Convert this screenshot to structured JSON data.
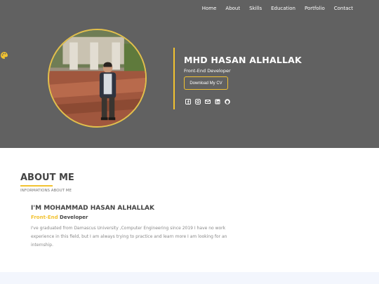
{
  "nav": {
    "items": [
      "Home",
      "About",
      "Skills",
      "Education",
      "Portfolio",
      "Contact"
    ]
  },
  "hero": {
    "name": "MHD HASAN ALHALLAK",
    "role": "Front-End Developer",
    "cv_button": "Download My CV",
    "socials": [
      "facebook-icon",
      "instagram-icon",
      "email-icon",
      "linkedin-icon",
      "github-icon"
    ]
  },
  "about": {
    "title": "ABOUT ME",
    "subtitle": "INFORMATIONS ABOUT ME",
    "heading": "I'M MOHAMMAD HASAN ALHALLAK",
    "role_highlight": "Front-End",
    "role_rest": "Developer",
    "text": "I've graduated from Damascus University ,Computer Engineering since 2019 I have no work experience in this field, but I am always trying to practice and learn more I am looking for an internship."
  },
  "colors": {
    "hero_bg": "#616161",
    "accent": "#f2c230",
    "heading": "#444444",
    "body_text": "#888888"
  }
}
